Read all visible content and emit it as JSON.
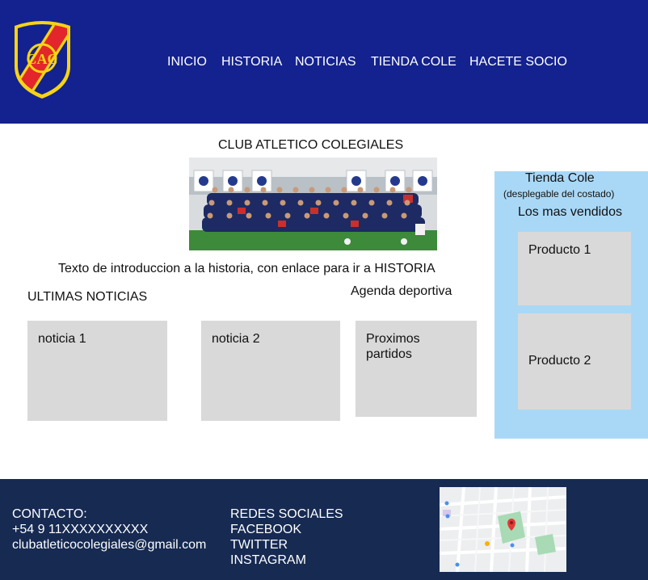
{
  "header": {
    "logo_text": "CAC",
    "nav": [
      {
        "label": "INICIO"
      },
      {
        "label": "HISTORIA"
      },
      {
        "label": "NOTICIAS"
      },
      {
        "label": "TIENDA COLE"
      },
      {
        "label": "HACETE SOCIO"
      }
    ]
  },
  "main": {
    "title": "CLUB ATLETICO COLEGIALES",
    "intro": "Texto de introduccion a la historia, con enlace para ir a HISTORIA",
    "news_heading": "ULTIMAS NOTICIAS",
    "news": [
      {
        "label": "noticia 1"
      },
      {
        "label": "noticia 2"
      }
    ],
    "agenda_heading": "Agenda deportiva",
    "agenda_card": "Proximos partidos"
  },
  "shop": {
    "title": "Tienda Cole",
    "subtitle": "(desplegable del costado)",
    "best_heading": "Los mas vendidos",
    "products": [
      {
        "label": "Producto 1"
      },
      {
        "label": "Producto 2"
      }
    ]
  },
  "footer": {
    "contact_label": "CONTACTO:",
    "phone": "+54 9 11XXXXXXXXXX",
    "email": "clubatleticocolegiales@gmail.com",
    "social_heading": "REDES SOCIALES",
    "social": [
      {
        "label": "FACEBOOK"
      },
      {
        "label": "TWITTER"
      },
      {
        "label": "INSTAGRAM"
      }
    ]
  },
  "colors": {
    "header_bg": "#13228e",
    "footer_bg": "#162a52",
    "shop_bg": "#a9d8f7",
    "card_bg": "#d9d9d9",
    "logo_red": "#e3262b",
    "logo_yellow": "#f6d415"
  }
}
